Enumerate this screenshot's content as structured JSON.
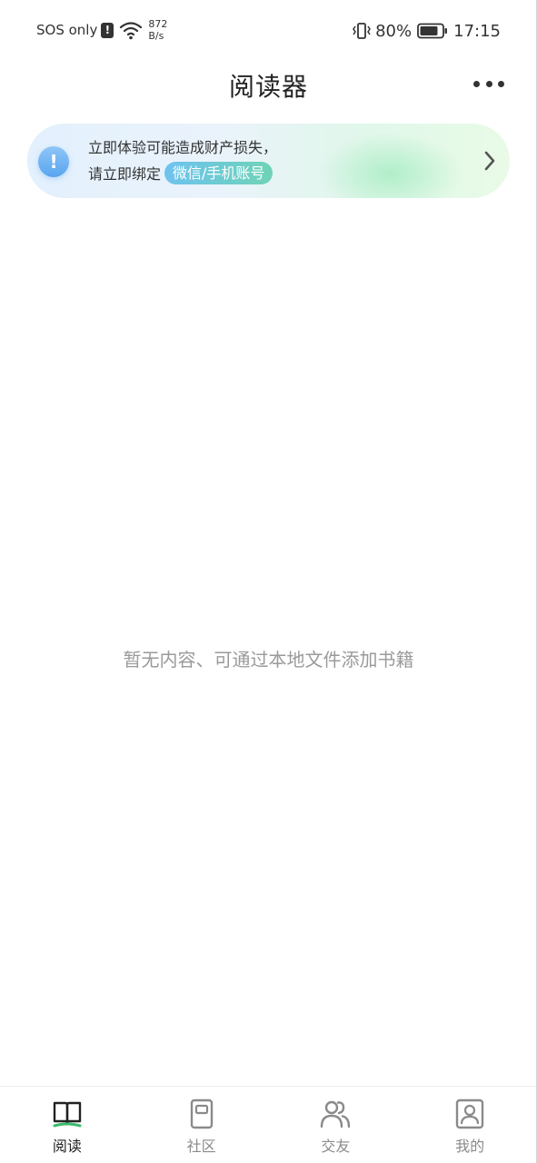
{
  "status_bar": {
    "carrier": "SOS only",
    "net_speed_value": "872",
    "net_speed_unit": "B/s",
    "battery": "80%",
    "time": "17:15",
    "icons": [
      "alert-icon",
      "wifi-icon",
      "vibrate-icon",
      "battery-icon"
    ]
  },
  "header": {
    "title": "阅读器",
    "more_icon": "more-dots-icon"
  },
  "banner": {
    "line1": "立即体验可能造成财产损失，",
    "line2_prefix": "请立即绑定",
    "chip": "微信/手机账号",
    "alert_glyph": "!",
    "icon": "info-alert-icon",
    "arrow_icon": "chevron-right-icon"
  },
  "main": {
    "empty_text": "暂无内容、可通过本地文件添加书籍"
  },
  "bottom_nav": {
    "items": [
      {
        "label": "阅读",
        "icon": "book-open-icon",
        "active": true
      },
      {
        "label": "社区",
        "icon": "community-icon",
        "active": false
      },
      {
        "label": "交友",
        "icon": "friends-icon",
        "active": false
      },
      {
        "label": "我的",
        "icon": "profile-icon",
        "active": false
      }
    ]
  },
  "colors": {
    "accent_green": "#3cba6d",
    "chip_gradient_start": "#6ec3ef",
    "chip_gradient_end": "#6fd3b6",
    "alert_blue": "#5aa5f0",
    "empty_text": "#9a9a9a"
  }
}
